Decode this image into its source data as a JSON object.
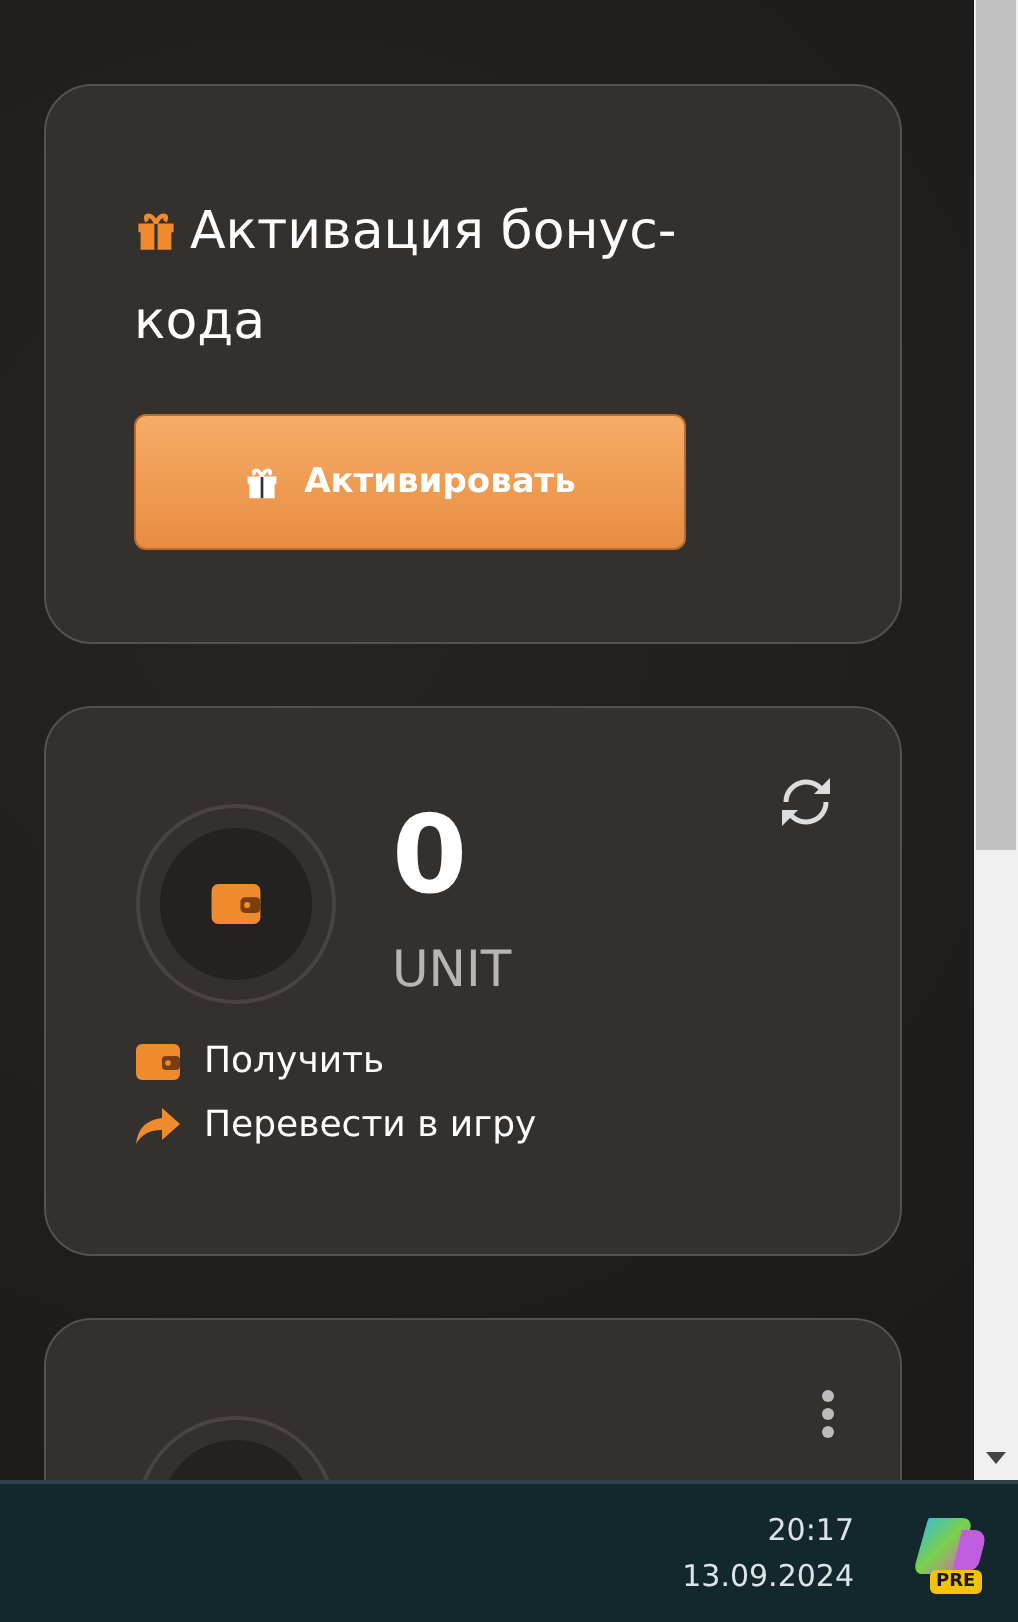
{
  "bonus_card": {
    "title": "Активация бонус-кода",
    "button": "Активировать"
  },
  "wallet_cards": [
    {
      "kind": "refresh",
      "amount": "0",
      "unit": "UNIT",
      "actions": [
        {
          "kind": "wallet",
          "label": "Получить"
        },
        {
          "kind": "arrow",
          "label": "Перевести в игру"
        }
      ]
    },
    {
      "kind": "menu"
    }
  ],
  "taskbar": {
    "time": "20:17",
    "date": "13.09.2024",
    "app_badge": "PRE"
  }
}
